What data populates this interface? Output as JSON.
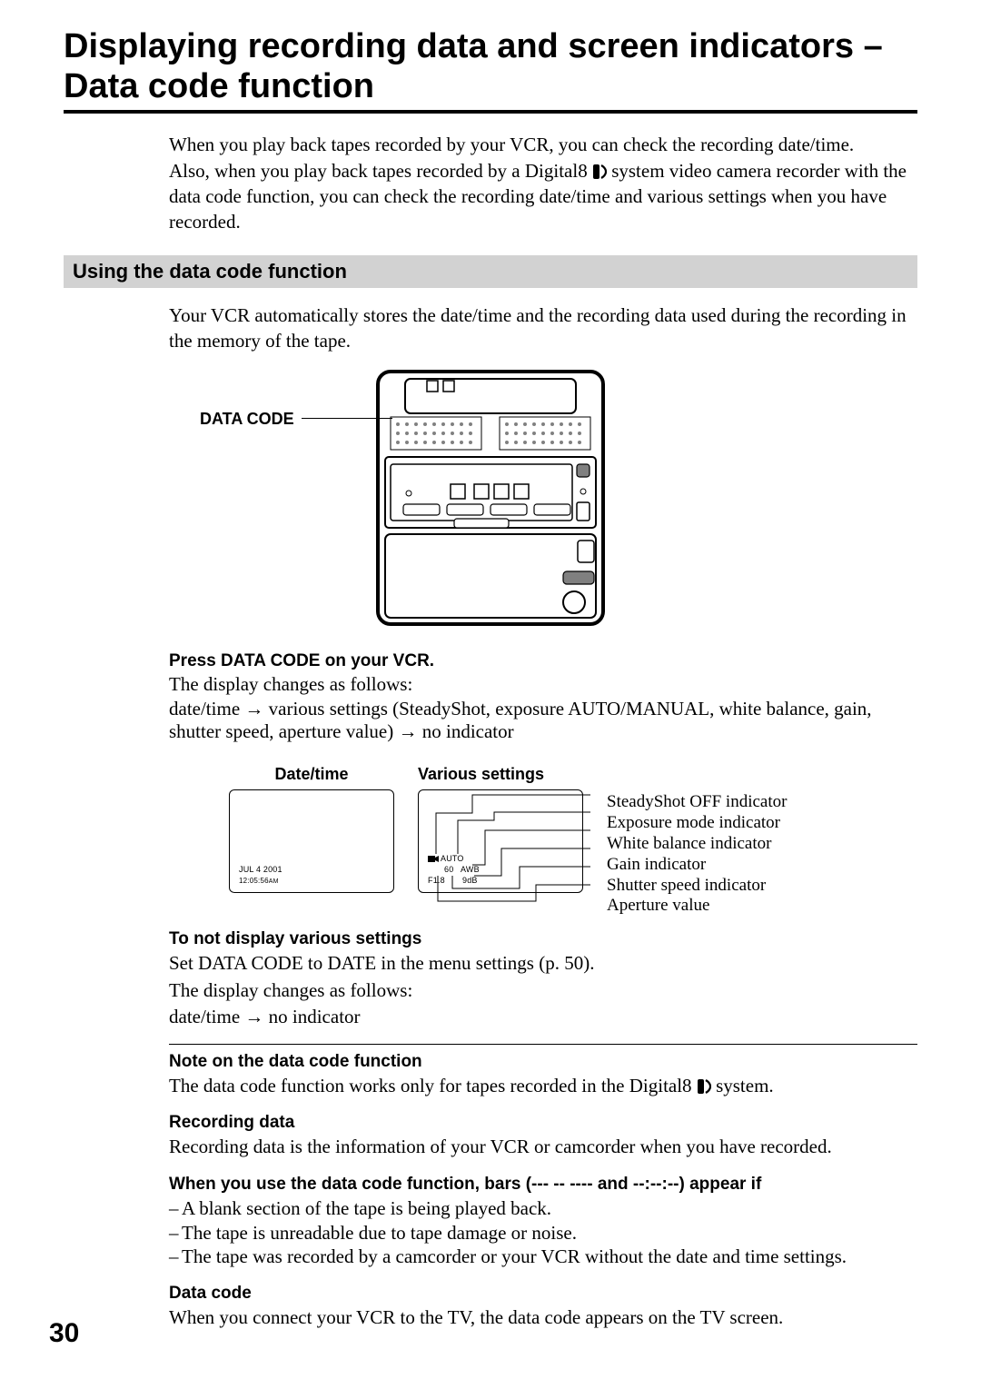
{
  "title": "Displaying recording data and screen indicators – Data code function",
  "intro": {
    "p1": "When you play back tapes recorded by your VCR, you can check the recording date/time.",
    "p2a": "Also, when you play back tapes recorded by a Digital8 ",
    "p2b": " system video camera recorder with the data code function, you can check the recording date/time and various settings when you have recorded."
  },
  "section_bar": "Using the data code function",
  "section_text": "Your VCR automatically stores the date/time and the recording data used during the recording in the memory of the tape.",
  "device_label": "DATA CODE",
  "instr": {
    "head": "Press DATA CODE on your VCR.",
    "line1": "The display changes as follows:",
    "line2a": "date/time ",
    "line2b": " various settings (SteadyShot, exposure AUTO/MANUAL, white balance, gain, shutter speed, aperture value) ",
    "line2c": " no indicator"
  },
  "arrow_glyph": "→",
  "screens": {
    "dt_title": "Date/time",
    "vs_title": "Various settings",
    "dt_line1": "JUL   4  2001",
    "dt_line2": "12:05:56",
    "dt_ampm": "AM",
    "vs_auto": "AUTO",
    "vs_60": "60",
    "vs_awb": "AWB",
    "vs_f18": "F1.8",
    "vs_9db": "9dB"
  },
  "indicators": {
    "i1": "SteadyShot OFF indicator",
    "i2": "Exposure mode indicator",
    "i3": "White balance indicator",
    "i4": "Gain indicator",
    "i5": "Shutter speed indicator",
    "i6": "Aperture value"
  },
  "sub1": {
    "head": "To not display various settings",
    "p1": "Set DATA CODE to DATE in the menu settings (p. 50).",
    "p2": "The display changes as follows:",
    "p3a": "date/time ",
    "p3b": " no indicator"
  },
  "sub2": {
    "head": "Note on the data code function",
    "p1a": "The data code function works only for tapes recorded in the Digital8 ",
    "p1b": " system."
  },
  "sub3": {
    "head": "Recording data",
    "p1": "Recording data is the information of your VCR or camcorder when you have recorded."
  },
  "sub4": {
    "head": "When you use the data code function, bars (--- -- ---- and --:--:--) appear if",
    "b1": "A blank section of the tape is being played back.",
    "b2": "The tape is unreadable due to tape damage or noise.",
    "b3": "The tape was recorded by a camcorder or your VCR without the date and time settings."
  },
  "sub5": {
    "head": "Data code",
    "p1": "When you connect your VCR to the TV, the data code appears on the TV screen."
  },
  "page_num": "30"
}
